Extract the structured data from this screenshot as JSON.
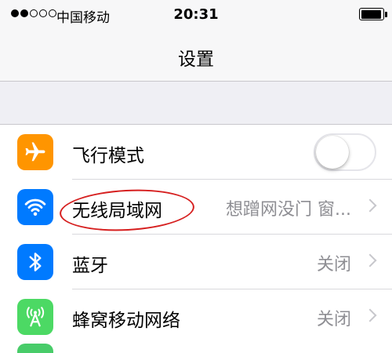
{
  "status_bar": {
    "carrier": "中国移动",
    "time": "20:31",
    "signal_bars_filled": 2,
    "signal_bars_total": 5,
    "battery_level": 0.95
  },
  "nav": {
    "title": "设置"
  },
  "colors": {
    "airplane_icon_bg": "#ff9500",
    "wifi_icon_bg": "#007aff",
    "bluetooth_icon_bg": "#007aff",
    "cellular_icon_bg": "#4cd964",
    "annotation_circle": "#d61f1f"
  },
  "settings": {
    "airplane": {
      "label": "飞行模式",
      "toggle_on": false,
      "icon": "airplane-icon"
    },
    "wifi": {
      "label": "无线局域网",
      "value": "想蹭网没门 窗...",
      "icon": "wifi-icon"
    },
    "bluetooth": {
      "label": "蓝牙",
      "value": "关闭",
      "icon": "bluetooth-icon"
    },
    "cellular": {
      "label": "蜂窝移动网络",
      "value": "关闭",
      "icon": "cellular-icon"
    }
  }
}
